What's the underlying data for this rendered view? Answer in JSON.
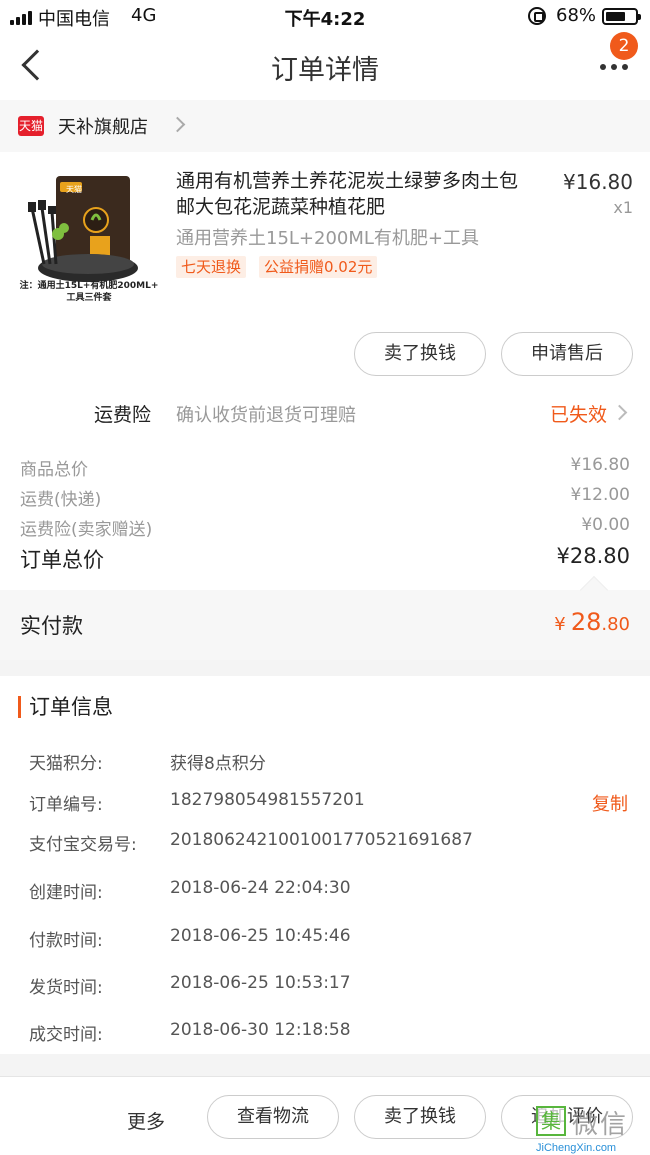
{
  "status_bar": {
    "carrier": "中国电信",
    "network": "4G",
    "time": "下午4:22",
    "battery": "68%",
    "battery_level": 0.68
  },
  "nav": {
    "title": "订单详情",
    "badge_count": "2"
  },
  "shop": {
    "brand_icon": "天猫",
    "name": "天补旗舰店"
  },
  "product": {
    "title": "通用有机营养土养花泥炭土绿萝多肉土包邮大包花泥蔬菜种植花肥",
    "spec": "通用营养土15L+200ML有机肥+工具",
    "price": "¥16.80",
    "qty": "x1",
    "tags": [
      "七天退换",
      "公益捐赠0.02元"
    ],
    "image_caption_1": "注：通用土15L+有机肥200ML+",
    "image_caption_2": "工具三件套",
    "image_brand": "天猫"
  },
  "item_actions": {
    "sell_exchange": "卖了换钱",
    "after_sale": "申请售后"
  },
  "insurance": {
    "label": "运费险",
    "desc": "确认收货前退货可理赔",
    "status": "已失效"
  },
  "summary": {
    "goods_label": "商品总价",
    "goods_value": "¥16.80",
    "shipping_label": "运费(快递)",
    "shipping_value": "¥12.00",
    "insurance_label": "运费险(卖家赠送)",
    "insurance_value": "¥0.00",
    "total_label": "订单总价",
    "total_value": "¥28.80"
  },
  "paid": {
    "label": "实付款",
    "yen": "¥",
    "integer": "28",
    "decimal": ".80"
  },
  "order_info": {
    "heading": "订单信息",
    "rows": [
      {
        "label": "天猫积分:",
        "value": "获得8点积分"
      },
      {
        "label": "订单编号:",
        "value": "182798054981557201"
      },
      {
        "label": "支付宝交易号:",
        "value": "2018062421001001770521691687"
      },
      {
        "label": "创建时间:",
        "value": "2018-06-24 22:04:30"
      },
      {
        "label": "付款时间:",
        "value": "2018-06-25 10:45:46"
      },
      {
        "label": "发货时间:",
        "value": "2018-06-25 10:53:17"
      },
      {
        "label": "成交时间:",
        "value": "2018-06-30 12:18:58"
      }
    ],
    "copy": "复制"
  },
  "bottom_bar": {
    "more": "更多",
    "logistics": "查看物流",
    "sell_exchange": "卖了换钱",
    "review": "追加评价"
  },
  "watermark": {
    "logo": "集",
    "text": "微信",
    "url": "JiChengXin.com"
  },
  "colors": {
    "accent": "#f05a1b",
    "tmall_red": "#e5202c"
  }
}
